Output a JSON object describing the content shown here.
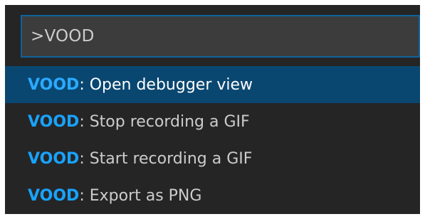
{
  "command_palette": {
    "input_value": ">VOOD",
    "items": [
      {
        "match": "VOOD",
        "rest": ": Open debugger view",
        "selected": true
      },
      {
        "match": "VOOD",
        "rest": ": Stop recording a GIF",
        "selected": false
      },
      {
        "match": "VOOD",
        "rest": ": Start recording a GIF",
        "selected": false
      },
      {
        "match": "VOOD",
        "rest": ": Export as PNG",
        "selected": false
      }
    ]
  },
  "colors": {
    "background": "#252526",
    "input_background": "#3c3c3c",
    "input_border": "#0e639c",
    "selected_row": "#094771",
    "match_highlight": "#18a3ff",
    "text": "#cccccc"
  }
}
